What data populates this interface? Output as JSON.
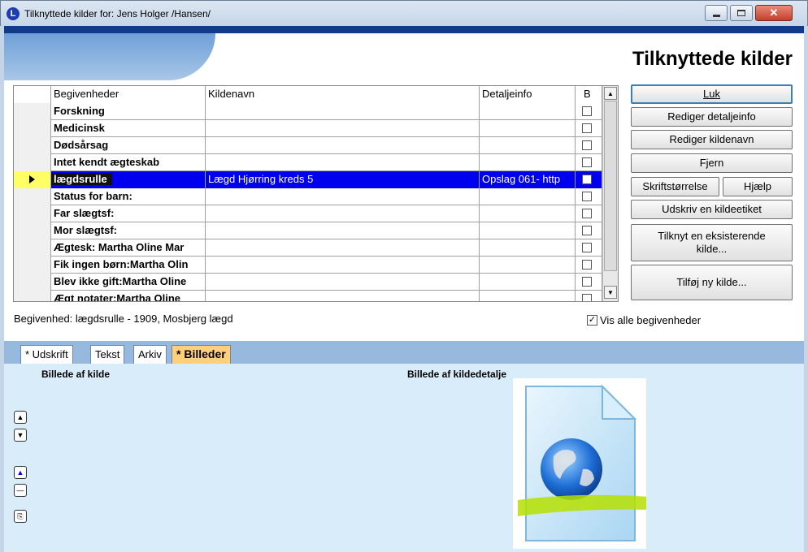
{
  "window": {
    "title": "Tilknyttede kilder for: Jens Holger /Hansen/",
    "app_icon": "L"
  },
  "header": {
    "title": "Tilknyttede kilder"
  },
  "grid": {
    "columns": [
      "Begivenheder",
      "Kildenavn",
      "Detaljeinfo",
      "B"
    ],
    "rows": [
      {
        "event": "Forskning",
        "source": "",
        "detail": "",
        "checked": false,
        "selected": false
      },
      {
        "event": "Medicinsk",
        "source": "",
        "detail": "",
        "checked": false,
        "selected": false
      },
      {
        "event": "Dødsårsag",
        "source": "",
        "detail": "",
        "checked": false,
        "selected": false
      },
      {
        "event": "Intet kendt ægteskab",
        "source": "",
        "detail": "",
        "checked": false,
        "selected": false
      },
      {
        "event": "lægdsrulle",
        "source": "Lægd Hjørring kreds 5",
        "detail": "Opslag 061- http",
        "checked": false,
        "selected": true
      },
      {
        "event": "Status for barn:",
        "source": "",
        "detail": "",
        "checked": false,
        "selected": false
      },
      {
        "event": "Far slægtsf:",
        "source": "",
        "detail": "",
        "checked": false,
        "selected": false
      },
      {
        "event": "Mor slægtsf:",
        "source": "",
        "detail": "",
        "checked": false,
        "selected": false
      },
      {
        "event": "Ægtesk: Martha Oline Mar",
        "source": "",
        "detail": "",
        "checked": false,
        "selected": false
      },
      {
        "event": "Fik ingen børn:Martha Olin",
        "source": "",
        "detail": "",
        "checked": false,
        "selected": false
      },
      {
        "event": "Blev ikke gift:Martha Oline",
        "source": "",
        "detail": "",
        "checked": false,
        "selected": false
      },
      {
        "event": "Ægt notater:Martha Oline",
        "source": "",
        "detail": "",
        "checked": false,
        "selected": false
      }
    ]
  },
  "buttons": {
    "luk": "Luk",
    "rediger_detaljeinfo": "Rediger detaljeinfo",
    "rediger_kildenavn": "Rediger kildenavn",
    "fjern": "Fjern",
    "skriftstorrelse": "Skriftstørrelse",
    "hjaelp": "Hjælp",
    "udskriv_kildeetiket": "Udskriv en kildeetiket",
    "tilknyt_eksisterende_line1": "Tilknyt en eksisterende",
    "tilknyt_eksisterende_line2": "kilde...",
    "tilfoj_ny_kilde": "Tilføj ny kilde..."
  },
  "status_text": "Begivenhed: lægdsrulle - 1909, Mosbjerg lægd",
  "vis_alle": {
    "label": "Vis alle begivenheder",
    "checked": true
  },
  "tabs": [
    {
      "label": "* Udskrift",
      "active": false
    },
    {
      "label": "Tekst",
      "active": false
    },
    {
      "label": "Arkiv",
      "active": false
    },
    {
      "label": "* Billeder",
      "active": true
    }
  ],
  "panel": {
    "left_label": "Billede af kilde",
    "right_label": "Billede af kildedetalje"
  },
  "icons": {
    "selected_row": "row-pointer-icon",
    "web_document": "web-document-icon"
  },
  "colors": {
    "selection": "#0000ee",
    "header_band": "#113a8a",
    "panel_bg": "#d9ecfa",
    "active_tab": "#ffcf7a"
  }
}
